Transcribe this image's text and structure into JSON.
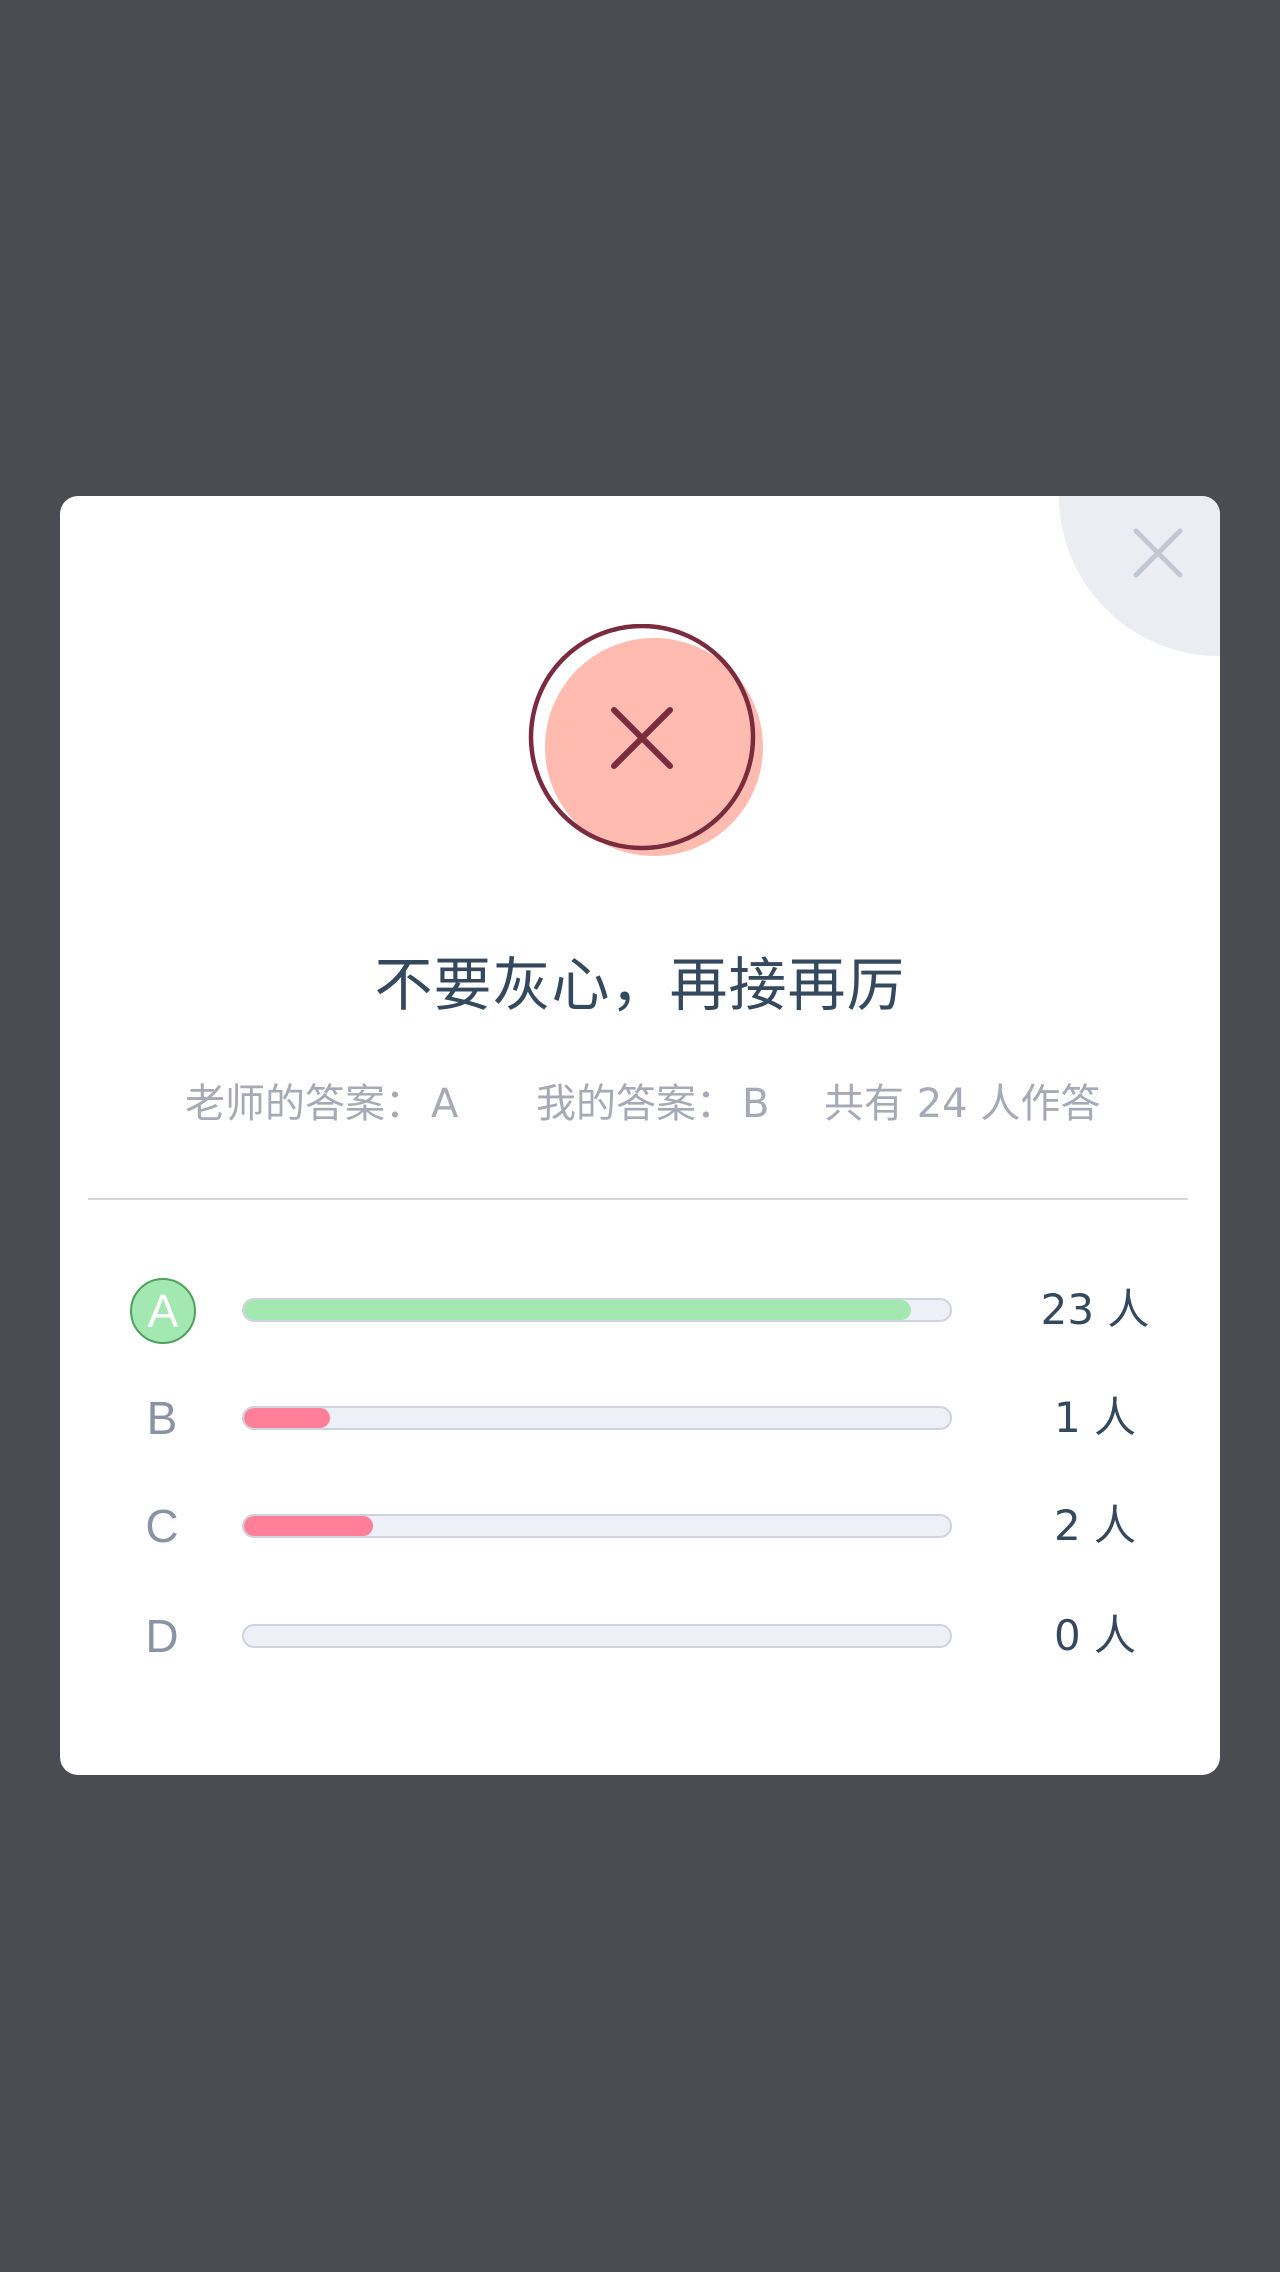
{
  "modal": {
    "title": "不要灰心，再接再厉",
    "close_icon": "close-icon",
    "result_icon": "wrong-x-icon",
    "colors": {
      "result_fill": "#ffbbb0",
      "result_stroke": "#7a2b3d",
      "correct_bar": "#a3e8b0",
      "wrong_bar": "#ff7f98"
    }
  },
  "info": {
    "teacher_label": "老师的答案",
    "teacher_answer": "A",
    "my_label": "我的答案",
    "my_answer": "B",
    "total_prefix": "共有",
    "total_count": "24",
    "total_suffix": "人作答"
  },
  "options": [
    {
      "letter": "A",
      "count_text": "23 人",
      "fraction": 0.945,
      "correct": true
    },
    {
      "letter": "B",
      "count_text": "1 人",
      "fraction": 0.122,
      "correct": false
    },
    {
      "letter": "C",
      "count_text": "2 人",
      "fraction": 0.183,
      "correct": false
    },
    {
      "letter": "D",
      "count_text": "0 人",
      "fraction": 0,
      "correct": false
    }
  ]
}
